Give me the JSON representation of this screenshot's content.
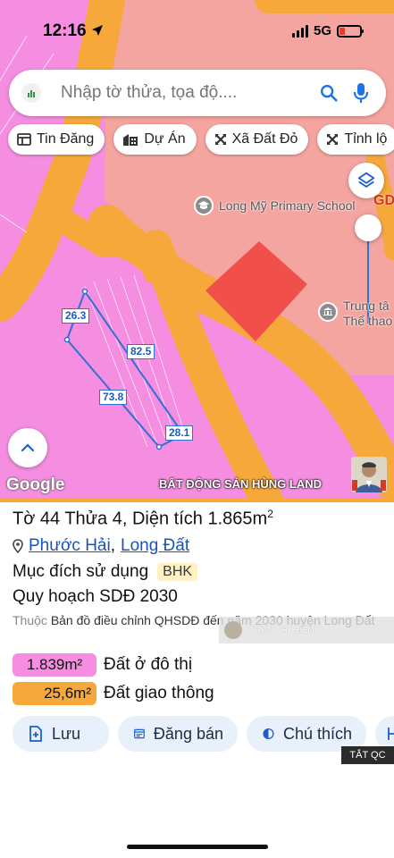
{
  "status": {
    "time": "12:16",
    "network": "5G"
  },
  "search": {
    "placeholder": "Nhập tờ thửa, tọa độ...."
  },
  "chips": [
    {
      "label": "Tin Đăng",
      "icon": "newspaper-icon"
    },
    {
      "label": "Dự Án",
      "icon": "buildings-icon"
    },
    {
      "label": "Xã Đất Đỏ",
      "icon": "cross-arrows-icon"
    },
    {
      "label": "Tỉnh lộ",
      "icon": "cross-arrows-icon"
    }
  ],
  "map": {
    "pois": [
      {
        "label": "Long Mỹ Primary School",
        "icon": "school-icon"
      },
      {
        "label": "Trung tâ\nThể thao",
        "icon": "stadium-icon"
      }
    ],
    "partial_label": "GD",
    "dimensions": [
      "26.3",
      "82.5",
      "73.8",
      "28.1"
    ],
    "google_logo": "Google",
    "watermark": "BẤT ĐỘNG SẢN HÙNG LAND"
  },
  "parcel": {
    "title_pre": "Tờ 44 Thửa 4, Diện tích ",
    "area": "1.865m",
    "area_sup": "2",
    "ward": "Phước Hải",
    "sep": ",",
    "district": "Long Đất",
    "purpose_label": "Mục đích sử dụng",
    "purpose_code": "BHK",
    "plan": "Quy hoạch SDĐ 2030",
    "source_prefix": "Thuộc",
    "source_text": "Bản đồ điều chỉnh QHSDĐ đến năm 2030 huyện Long Đất",
    "staff_name": "TRẦN THỊ HIỀN",
    "legend": [
      {
        "value": "1.839m²",
        "label": "Đất ở đô thị",
        "color": "#f58ee0",
        "border": "#d15cbc"
      },
      {
        "value": "25,6m²",
        "label": "Đất giao thông",
        "color": "#f6a83a",
        "border": "#e58e1a"
      }
    ]
  },
  "actions": [
    {
      "label": "Lưu",
      "icon": "bookmark-add-icon"
    },
    {
      "label": "Đăng bán",
      "icon": "listing-icon"
    },
    {
      "label": "Chú thích",
      "icon": "contrast-icon"
    },
    {
      "label": "",
      "icon": "share-icon"
    }
  ],
  "tat_qc": "TẮT QC",
  "colors": {
    "residential": "#f58ee0",
    "road": "#f6a83a",
    "public_land": "#f5a5a0",
    "building": "#f1504a",
    "accent": "#2f6fd6"
  }
}
